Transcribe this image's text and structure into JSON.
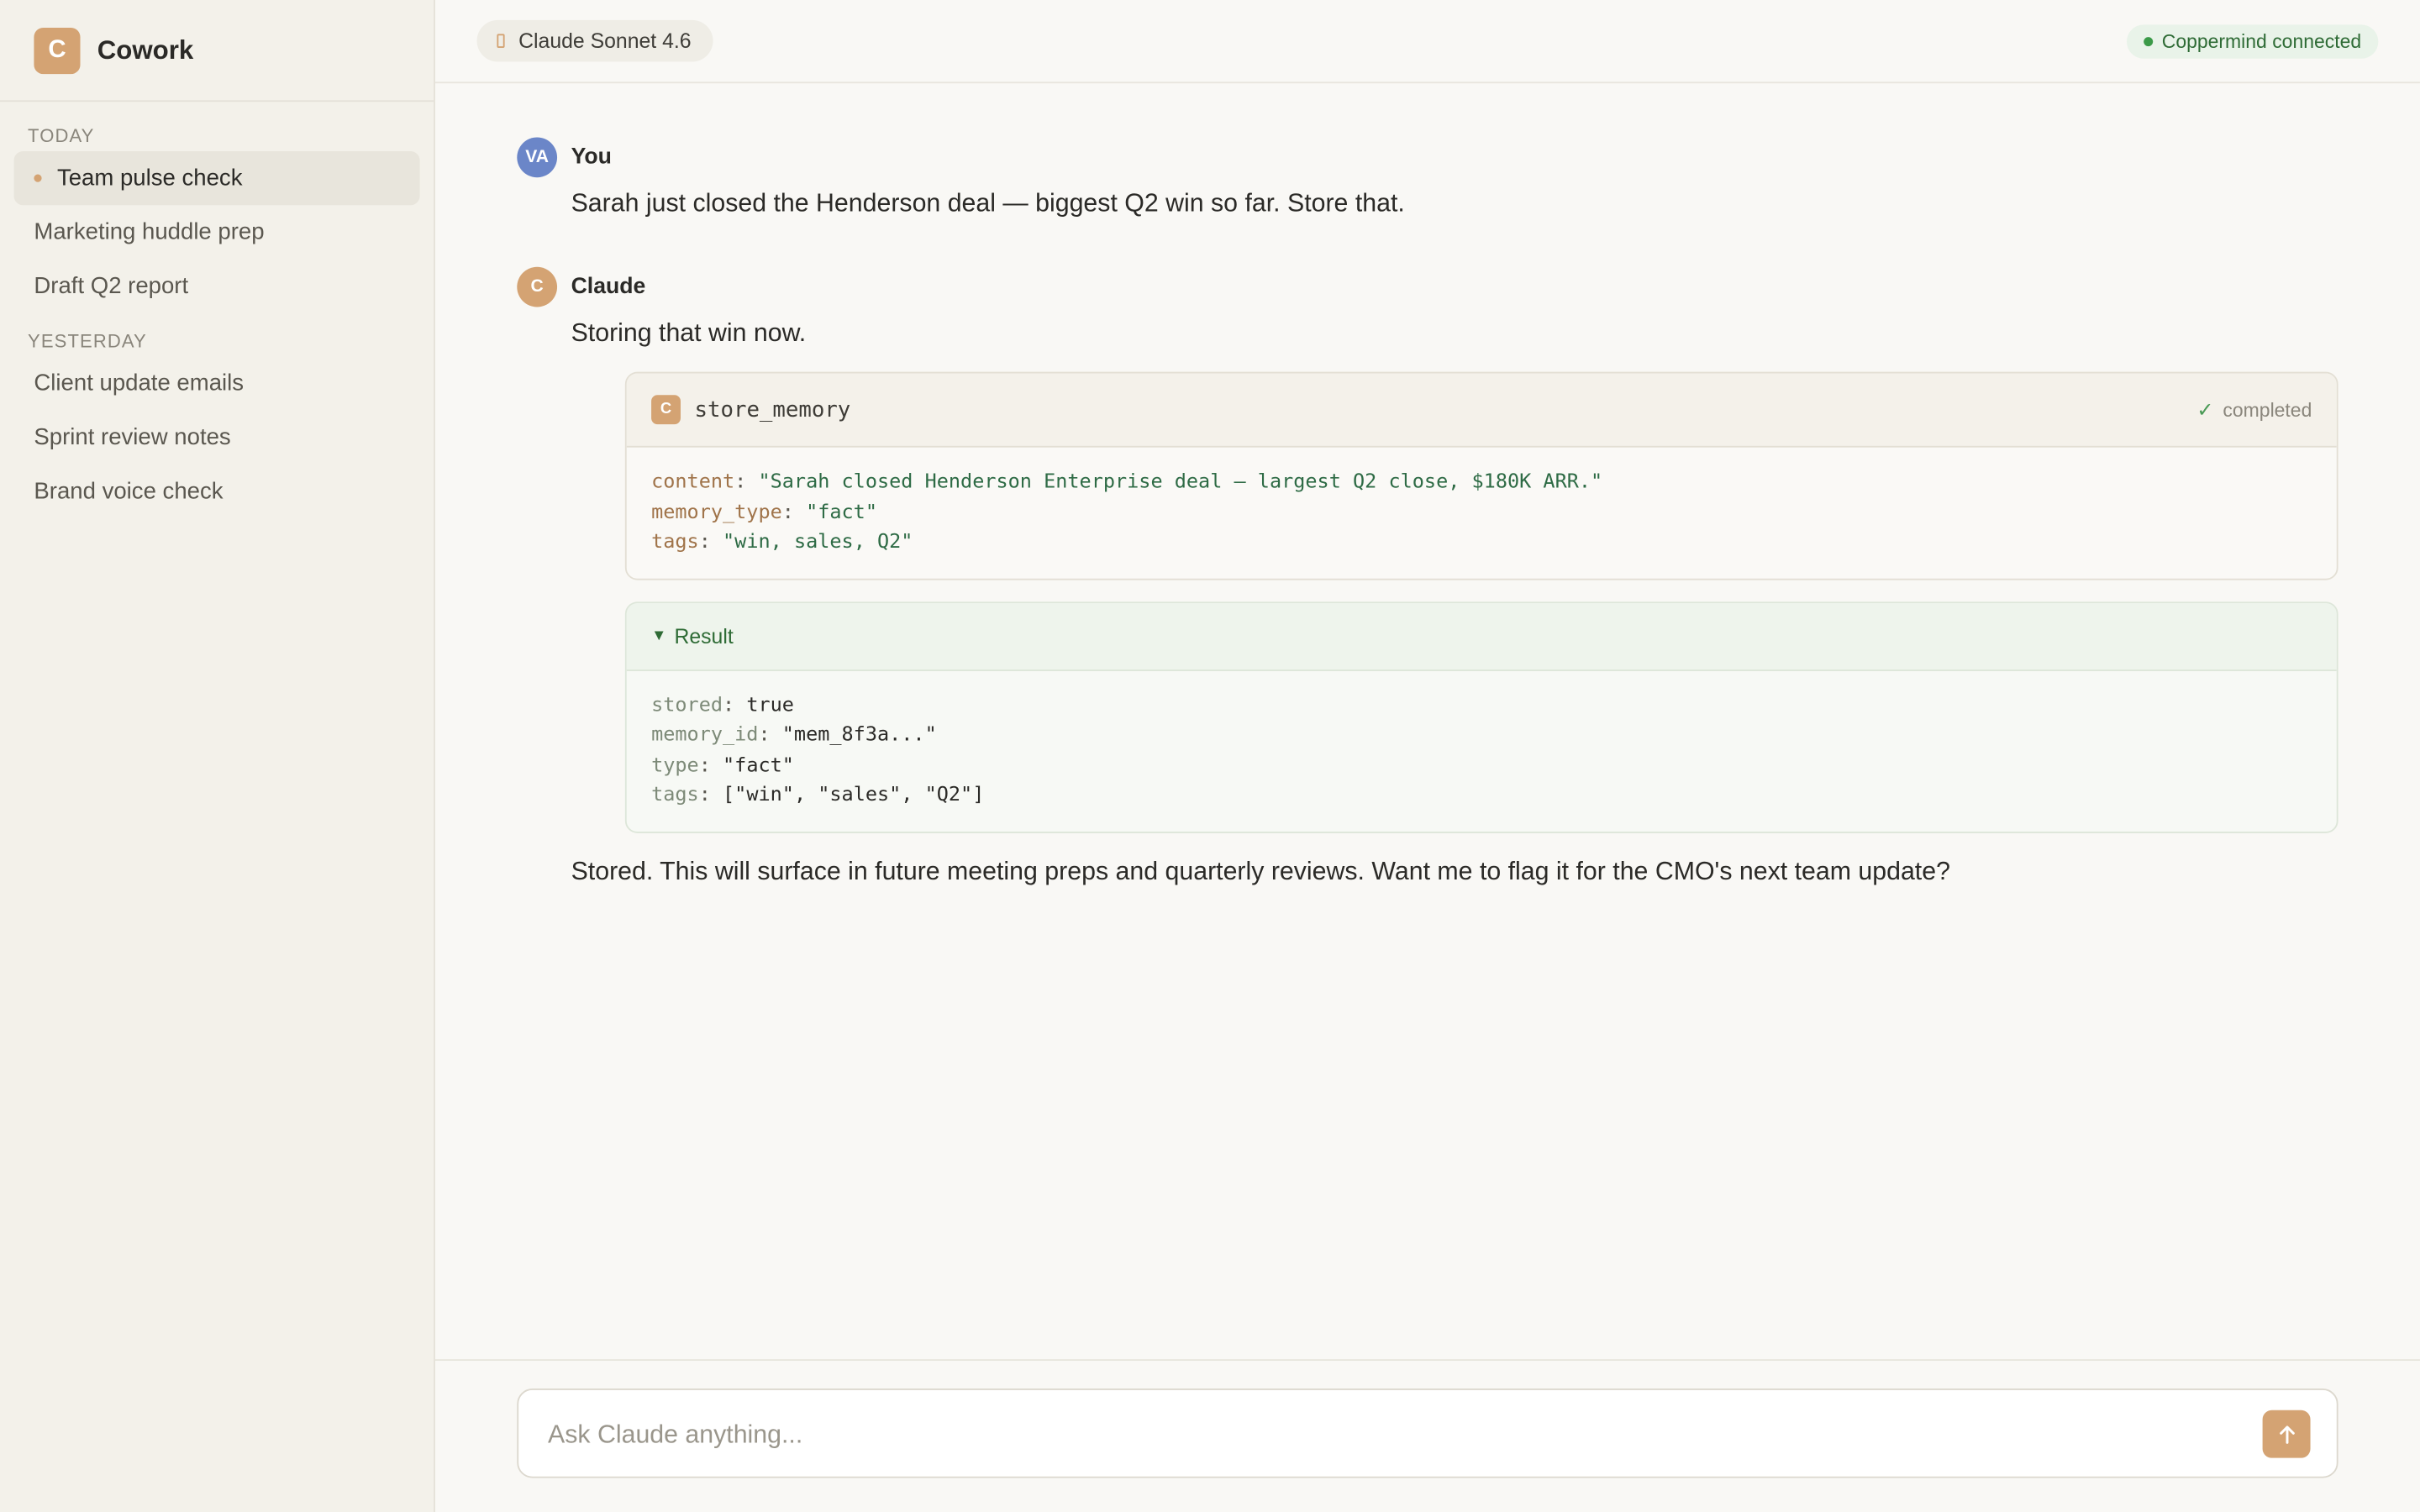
{
  "app": {
    "logo_letter": "C",
    "name": "Cowork"
  },
  "sidebar": {
    "sections": [
      {
        "label": "TODAY",
        "items": [
          {
            "label": "Team pulse check",
            "active": true
          },
          {
            "label": "Marketing huddle prep",
            "active": false
          },
          {
            "label": "Draft Q2 report",
            "active": false
          }
        ]
      },
      {
        "label": "YESTERDAY",
        "items": [
          {
            "label": "Client update emails",
            "active": false
          },
          {
            "label": "Sprint review notes",
            "active": false
          },
          {
            "label": "Brand voice check",
            "active": false
          }
        ]
      }
    ]
  },
  "topbar": {
    "model": "Claude Sonnet 4.6",
    "connection_status": "Coppermind connected"
  },
  "conversation": {
    "user": {
      "initials": "VA",
      "name": "You",
      "text": "Sarah just closed the Henderson deal — biggest Q2 win so far. Store that."
    },
    "assistant": {
      "initial": "C",
      "name": "Claude",
      "intro": "Storing that win now.",
      "tool_call": {
        "icon_letter": "C",
        "name": "store_memory",
        "status": "completed",
        "params": [
          {
            "key": "content",
            "value": "\"Sarah closed Henderson Enterprise deal — largest Q2 close, $180K ARR.\""
          },
          {
            "key": "memory_type",
            "value": "\"fact\""
          },
          {
            "key": "tags",
            "value": "\"win, sales, Q2\""
          }
        ]
      },
      "result": {
        "label": "Result",
        "fields": [
          {
            "key": "stored",
            "value": "true"
          },
          {
            "key": "memory_id",
            "value": "\"mem_8f3a...\""
          },
          {
            "key": "type",
            "value": "\"fact\""
          },
          {
            "key": "tags",
            "value": "[\"win\", \"sales\", \"Q2\"]"
          }
        ]
      },
      "final": "Stored. This will surface in future meeting preps and quarterly reviews. Want me to flag it for the CMO's next team update?"
    }
  },
  "composer": {
    "placeholder": "Ask Claude anything...",
    "value": ""
  },
  "colors": {
    "accent": "#d4a373",
    "user_avatar": "#6b86c8",
    "success": "#3b9a48"
  },
  "icons": {
    "send": "arrow-up-icon",
    "status": "check-icon",
    "model": "model-icon",
    "result_toggle": "triangle-down-icon"
  }
}
